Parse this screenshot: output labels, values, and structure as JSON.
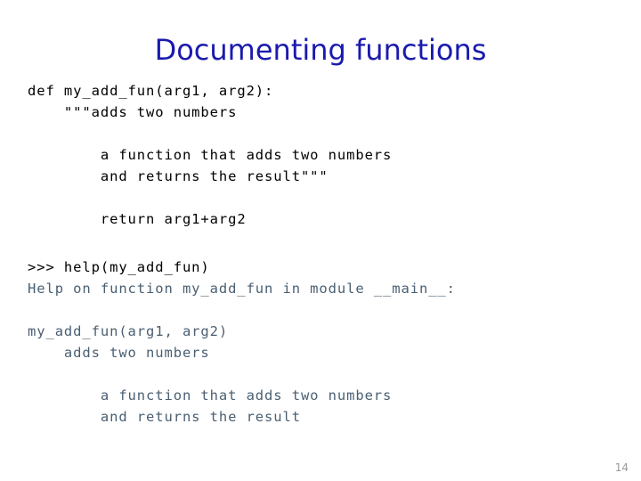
{
  "slide": {
    "title": "Documenting functions",
    "title_color": "#1a1aae",
    "page_number": "14",
    "page_number_color": "#9a9a9a"
  },
  "source_code": {
    "color": "#000000",
    "block_1": "def my_add_fun(arg1, arg2):\n    \"\"\"adds two numbers",
    "block_2": "        a function that adds two numbers\n        and returns the result\"\"\"",
    "block_3": "        return arg1+arg2"
  },
  "console": {
    "prompt_color": "#000000",
    "output_color": "#4a5f72",
    "prompt_line": ">>> help(my_add_fun)",
    "help_header": "Help on function my_add_fun in module __main__:",
    "help_signature": "my_add_fun(arg1, arg2)\n    adds two numbers",
    "help_body": "        a function that adds two numbers\n        and returns the result"
  }
}
